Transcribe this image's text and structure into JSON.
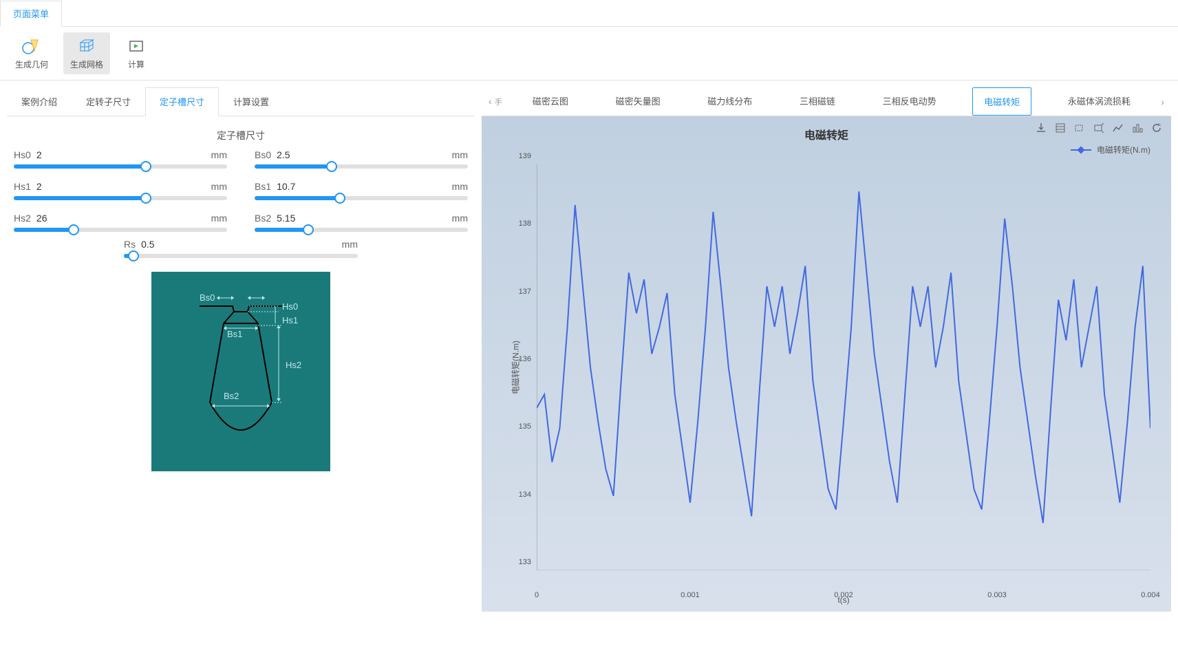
{
  "menu": {
    "page_menu": "页面菜单"
  },
  "toolbar": {
    "gen_geometry": "生成几何",
    "gen_mesh": "生成网格",
    "compute": "计算"
  },
  "left_tabs": [
    "案例介绍",
    "定转子尺寸",
    "定子槽尺寸",
    "计算设置"
  ],
  "left_active_tab": 2,
  "section_title": "定子槽尺寸",
  "sliders": [
    {
      "label": "Hs0",
      "value": "2",
      "unit": "mm",
      "pct": 62
    },
    {
      "label": "Bs0",
      "value": "2.5",
      "unit": "mm",
      "pct": 36
    },
    {
      "label": "Hs1",
      "value": "2",
      "unit": "mm",
      "pct": 62
    },
    {
      "label": "Bs1",
      "value": "10.7",
      "unit": "mm",
      "pct": 40
    },
    {
      "label": "Hs2",
      "value": "26",
      "unit": "mm",
      "pct": 28
    },
    {
      "label": "Bs2",
      "value": "5.15",
      "unit": "mm",
      "pct": 25
    }
  ],
  "slider_rs": {
    "label": "Rs",
    "value": "0.5",
    "unit": "mm",
    "pct": 4
  },
  "diagram_labels": {
    "bs0": "Bs0",
    "hs0": "Hs0",
    "bs1": "Bs1",
    "hs1": "Hs1",
    "bs2": "Bs2",
    "hs2": "Hs2"
  },
  "chart_tabs": [
    "磁密云图",
    "磁密矢量图",
    "磁力线分布",
    "三相磁链",
    "三相反电动势",
    "电磁转矩",
    "永磁体涡流损耗"
  ],
  "chart_active_tab": 5,
  "chart": {
    "title": "电磁转矩",
    "legend": "电磁转矩(N.m)",
    "xlabel": "t(s)",
    "ylabel": "电磁转矩(N.m)",
    "y_ticks": [
      "133",
      "134",
      "135",
      "136",
      "137",
      "138",
      "139"
    ],
    "x_ticks": [
      "0",
      "0.001",
      "0.002",
      "0.003",
      "0.004"
    ]
  },
  "chart_data": {
    "type": "line",
    "title": "电磁转矩",
    "xlabel": "t(s)",
    "ylabel": "电磁转矩(N.m)",
    "xlim": [
      0,
      0.004
    ],
    "ylim": [
      133,
      139
    ],
    "series": [
      {
        "name": "电磁转矩(N.m)",
        "x": [
          0,
          5e-05,
          0.0001,
          0.00015,
          0.0002,
          0.00025,
          0.0003,
          0.00035,
          0.0004,
          0.00045,
          0.0005,
          0.00055,
          0.0006,
          0.00065,
          0.0007,
          0.00075,
          0.0008,
          0.00085,
          0.0009,
          0.00095,
          0.001,
          0.00105,
          0.0011,
          0.00115,
          0.0012,
          0.00125,
          0.0013,
          0.00135,
          0.0014,
          0.00145,
          0.0015,
          0.00155,
          0.0016,
          0.00165,
          0.0017,
          0.00175,
          0.0018,
          0.00185,
          0.0019,
          0.00195,
          0.002,
          0.00205,
          0.0021,
          0.00215,
          0.0022,
          0.00225,
          0.0023,
          0.00235,
          0.0024,
          0.00245,
          0.0025,
          0.00255,
          0.0026,
          0.00265,
          0.0027,
          0.00275,
          0.0028,
          0.00285,
          0.0029,
          0.00295,
          0.003,
          0.00305,
          0.0031,
          0.00315,
          0.0032,
          0.00325,
          0.0033,
          0.00335,
          0.0034,
          0.00345,
          0.0035,
          0.00355,
          0.0036,
          0.00365,
          0.0037,
          0.00375,
          0.0038,
          0.00385,
          0.0039,
          0.00395,
          0.004
        ],
        "y": [
          135.4,
          135.6,
          134.6,
          135.1,
          136.6,
          138.4,
          137.2,
          136.0,
          135.2,
          134.5,
          134.1,
          135.8,
          137.4,
          136.8,
          137.3,
          136.2,
          136.6,
          137.1,
          135.6,
          134.8,
          134.0,
          135.2,
          136.6,
          138.3,
          137.2,
          136.0,
          135.2,
          134.5,
          133.8,
          135.6,
          137.2,
          136.6,
          137.2,
          136.2,
          136.8,
          137.5,
          135.8,
          135.0,
          134.2,
          133.9,
          135.2,
          136.6,
          138.6,
          137.4,
          136.2,
          135.4,
          134.6,
          134.0,
          135.6,
          137.2,
          136.6,
          137.2,
          136.0,
          136.6,
          137.4,
          135.8,
          135.0,
          134.2,
          133.9,
          135.2,
          136.6,
          138.2,
          137.2,
          136.0,
          135.2,
          134.4,
          133.7,
          135.4,
          137.0,
          136.4,
          137.3,
          136.0,
          136.6,
          137.2,
          135.6,
          134.8,
          134.0,
          135.2,
          136.6,
          137.5,
          135.1
        ]
      }
    ]
  }
}
